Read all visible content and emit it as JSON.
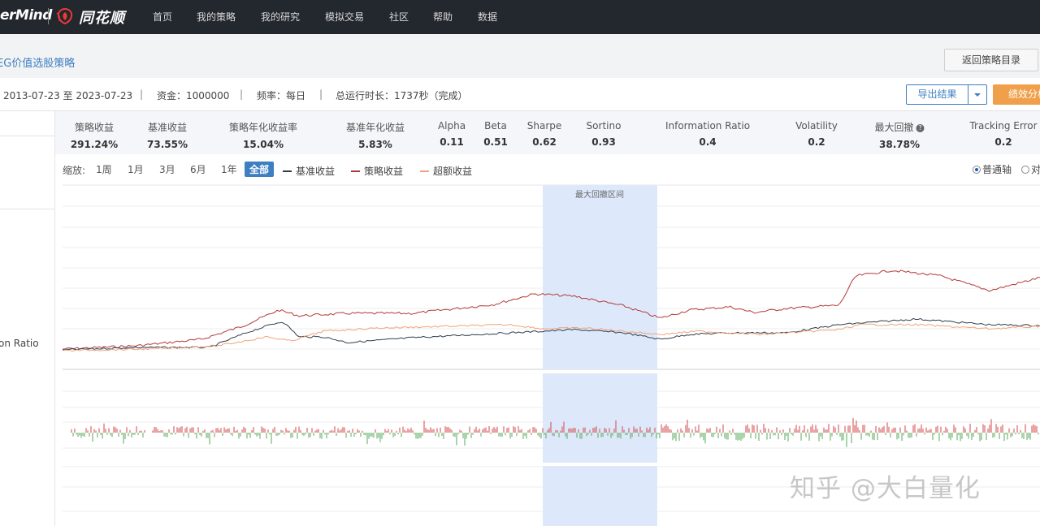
{
  "nav": {
    "logo": "erMind",
    "brand": "同花顺",
    "items": [
      "首页",
      "我的策略",
      "我的研究",
      "模拟交易",
      "社区",
      "帮助",
      "数据"
    ]
  },
  "header": {
    "strategy_title": "EG价值选股策略",
    "back_button": "返回策略目录"
  },
  "info": {
    "period": "2013-07-23 至 2023-07-23",
    "capital": "资金：1000000",
    "frequency": "频率：每日",
    "runtime": "总运行时长：1737秒（完成）",
    "export_button": "导出结果",
    "perf_button": "绩效分析"
  },
  "left_rail": {
    "label": "on Ratio"
  },
  "metrics": [
    {
      "label": "策略收益",
      "value": "291.24%"
    },
    {
      "label": "基准收益",
      "value": "73.55%"
    },
    {
      "label": "策略年化收益率",
      "value": "15.04%"
    },
    {
      "label": "基准年化收益",
      "value": "5.83%"
    },
    {
      "label": "Alpha",
      "value": "0.11"
    },
    {
      "label": "Beta",
      "value": "0.51"
    },
    {
      "label": "Sharpe",
      "value": "0.62"
    },
    {
      "label": "Sortino",
      "value": "0.93"
    },
    {
      "label": "Information Ratio",
      "value": "0.4"
    },
    {
      "label": "Volatility",
      "value": "0.2"
    },
    {
      "label": "最大回撤",
      "value": "38.78%",
      "help": "?"
    },
    {
      "label": "Tracking Error",
      "value": "0.2"
    }
  ],
  "toolbar": {
    "zoom_label": "缩放:",
    "zoom_options": [
      "1周",
      "1月",
      "3月",
      "6月",
      "1年",
      "全部"
    ],
    "active_zoom": "全部",
    "legend": [
      {
        "name": "基准收益",
        "color": "#2f3e4e"
      },
      {
        "name": "策略收益",
        "color": "#b23a3a"
      },
      {
        "name": "超额收益",
        "color": "#f0a47a"
      }
    ],
    "axis_normal": "普通轴",
    "axis_log": "对"
  },
  "chart": {
    "drawdown_label": "最大回撤区间"
  },
  "watermark": "知乎 @大白量化"
}
